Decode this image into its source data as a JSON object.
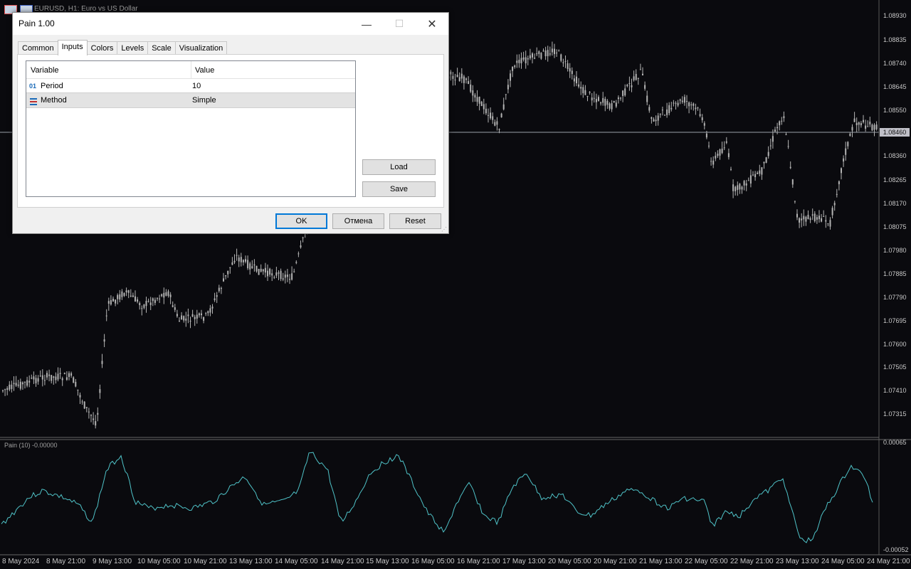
{
  "chart": {
    "title": "EURUSD, H1:  Euro vs US Dollar",
    "current_price": "1.08460",
    "price_axis": [
      "1.08930",
      "1.08835",
      "1.08740",
      "1.08645",
      "1.08550",
      "1.08360",
      "1.08265",
      "1.08170",
      "1.08075",
      "1.07980",
      "1.07885",
      "1.07790",
      "1.07695",
      "1.07600",
      "1.07505",
      "1.07410",
      "1.07315"
    ],
    "time_axis": [
      "8 May 2024",
      "8 May 21:00",
      "9 May 13:00",
      "10 May 05:00",
      "10 May 21:00",
      "13 May 13:00",
      "14 May 05:00",
      "14 May 21:00",
      "15 May 13:00",
      "16 May 05:00",
      "16 May 21:00",
      "17 May 13:00",
      "20 May 05:00",
      "20 May 21:00",
      "21 May 13:00",
      "22 May 05:00",
      "22 May 21:00",
      "23 May 13:00",
      "24 May 05:00",
      "24 May 21:00"
    ],
    "indicator_title": "Pain (10) -0.00000",
    "indicator_axis_top": "0.00065",
    "indicator_axis_bottom": "-0.00052",
    "colors": {
      "candle": "#b4b4b4",
      "indicator_line": "#4fc3c8",
      "background": "#0a0a0e"
    }
  },
  "dialog": {
    "title": "Pain 1.00",
    "tabs": [
      "Common",
      "Inputs",
      "Colors",
      "Levels",
      "Scale",
      "Visualization"
    ],
    "active_tab": "Inputs",
    "grid": {
      "headers": [
        "Variable",
        "Value"
      ],
      "rows": [
        {
          "icon": "01",
          "variable": "Period",
          "value": "10"
        },
        {
          "icon": "enum-icon",
          "variable": "Method",
          "value": "Simple"
        }
      ]
    },
    "buttons": {
      "load": "Load",
      "save": "Save",
      "ok": "OK",
      "cancel": "Отмена",
      "reset": "Reset"
    }
  }
}
